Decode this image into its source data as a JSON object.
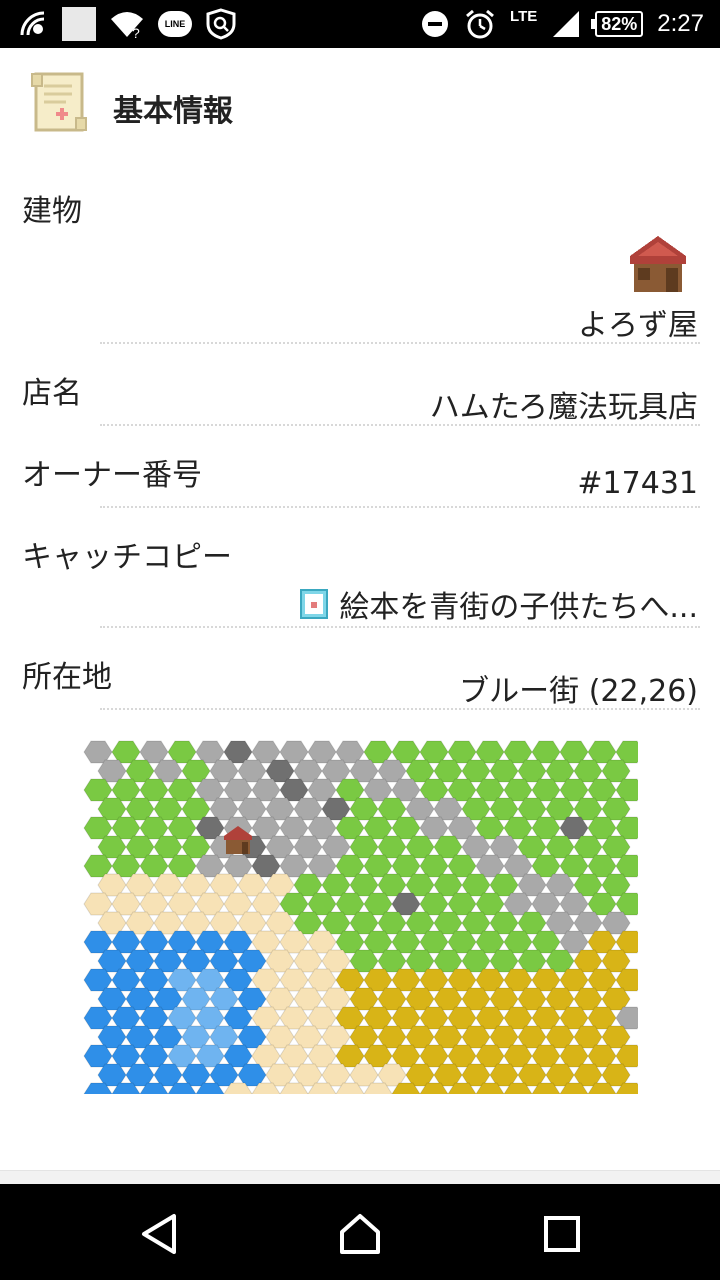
{
  "status_bar": {
    "time": "2:27",
    "battery": "82%",
    "network": "LTE",
    "icons": [
      "signal-icon",
      "image-icon",
      "wifi-question-icon",
      "line-icon",
      "shield-search-icon",
      "dnd-icon",
      "alarm-icon",
      "cell-signal-icon"
    ]
  },
  "header": {
    "title": "基本情報",
    "icon": "scroll-icon"
  },
  "rows": [
    {
      "label": "建物",
      "value": "よろず屋",
      "icon": "shop-house-icon"
    },
    {
      "label": "店名",
      "value": "ハムたろ魔法玩具店"
    },
    {
      "label": "オーナー番号",
      "value": "#17431"
    },
    {
      "label": "キャッチコピー",
      "value": "絵本を青街の子供たちへ...",
      "icon": "picture-book-icon"
    },
    {
      "label": "所在地",
      "value": "ブルー街 (22,26)"
    }
  ],
  "map": {
    "icon": "hex-map",
    "marker": "shop-house-icon"
  },
  "nav": {
    "back": "back-icon",
    "home": "home-icon",
    "recents": "recents-icon"
  },
  "colors": {
    "grass": "#7ac943",
    "stone": "#a9a9a9",
    "dark_stone": "#707070",
    "sand": "#f7e2b6",
    "water": "#2f8fe8",
    "light_water": "#6fb4f0",
    "gold": "#d8b417"
  }
}
